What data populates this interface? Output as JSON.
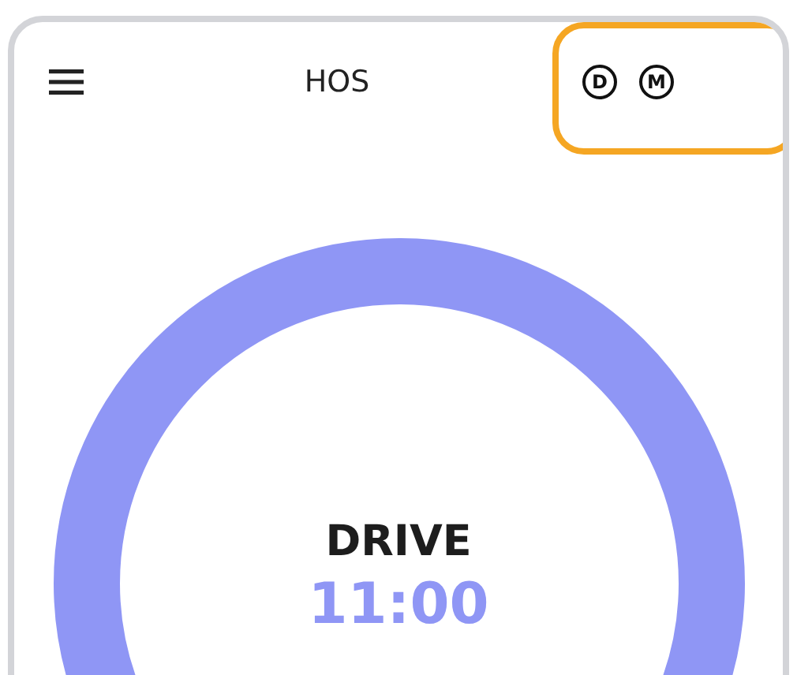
{
  "header": {
    "title": "HOS",
    "badges": [
      {
        "letter": "D"
      },
      {
        "letter": "M"
      }
    ],
    "highlighted": true
  },
  "gauge": {
    "label": "DRIVE",
    "time": "11:00"
  }
}
